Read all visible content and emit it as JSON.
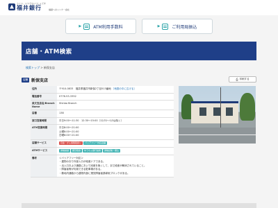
{
  "header": {
    "logo_tagline": "ふくい、いつでもいっしょです",
    "logo_name": "福井銀行",
    "logo_sub": "福銀へのリンク・会社"
  },
  "quicklinks": [
    {
      "label": "ATM利用手数料"
    },
    {
      "label": "ご利用局振込"
    }
  ],
  "page_title": "店舗・ATM検索",
  "breadcrumb": {
    "home": "検索トップ",
    "sep": " > ",
    "current": "新保支店"
  },
  "branch": {
    "tag": "店舗",
    "name": "新保支店"
  },
  "print_label": "印刷する",
  "info_rows": {
    "address": {
      "label": "住所",
      "value": "〒910-0833　福井県福井市新保2丁目513番地",
      "map_link": "［地図の中に広げる］"
    },
    "phone": {
      "label": "電話番号",
      "value": "0776-53-3352"
    },
    "english": {
      "label": "英文支店名/Branch Name",
      "value": "Shinbo Branch"
    },
    "number": {
      "label": "店番",
      "value": "138"
    },
    "hours": {
      "label": "窓口営業時間",
      "value": "平日9:00～11:30　12:30～15:00（12/31～1/3は除く）"
    },
    "atm_hours": {
      "label": "ATM営業時間",
      "lines": [
        "平日8:00～21:00",
        "土曜8:00～21:00",
        "日曜8:00～21:00"
      ]
    },
    "store_services": {
      "label": "店舗サービス",
      "tags": [
        {
          "text": "貸金・がん保険取扱い",
          "color": "red"
        },
        {
          "text": "バリアフリー対応店舗",
          "color": "teal"
        }
      ]
    },
    "atm_services": {
      "label": "ATMサービス",
      "tags": [
        {
          "text": "通帳繰越",
          "color": "teal"
        },
        {
          "text": "硬貨取扱",
          "color": "teal"
        },
        {
          "text": "ゆうちょ銀行提携",
          "color": "teal"
        },
        {
          "text": "通帳記帳・振込",
          "color": "teal"
        }
      ]
    },
    "notes": {
      "label": "備考",
      "lines": [
        "＜バリアフリー対応＞",
        "・建物のおり外部入口が段差ドアである。",
        "・出入口および通路において段差を無くして、まだ段差が解消されていること。",
        "・障害者等が利用できる駐車場がある。",
        "・敷地内通路から建物内部に視覚障害者誘導用ブロックがある。"
      ]
    }
  },
  "colors": {
    "brand": "#1f3f88",
    "accent": "#2aa3a8"
  }
}
